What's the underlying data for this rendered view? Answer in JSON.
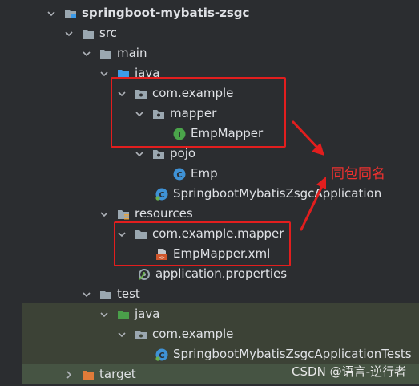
{
  "project": {
    "root": "springboot-mybatis-zsgc",
    "src": "src",
    "main": "main",
    "java": "java",
    "pkg": "com.example",
    "mapper": "mapper",
    "empMapper": "EmpMapper",
    "pojo": "pojo",
    "emp": "Emp",
    "app": "SpringbootMybatisZsgcApplication",
    "resources": "resources",
    "resMapperPkg": "com.example.mapper",
    "empMapperXml": "EmpMapper.xml",
    "appProps": "application.properties",
    "test": "test",
    "testJava": "java",
    "testPkg": "com.example",
    "appTests": "SpringbootMybatisZsgcApplicationTests",
    "target": "target"
  },
  "annotation": "同包同名",
  "watermark": "CSDN @语言-逆行者",
  "colors": {
    "background": "#2b2d30",
    "highlight_box": "#e21e1e",
    "folder": "#9aa7b0",
    "source_folder": "#3d9be9",
    "test_folder": "#4a9f4a",
    "excluded_folder": "#e07b39",
    "interface_icon": "#4aa44a",
    "class_icon": "#3f92d6"
  }
}
